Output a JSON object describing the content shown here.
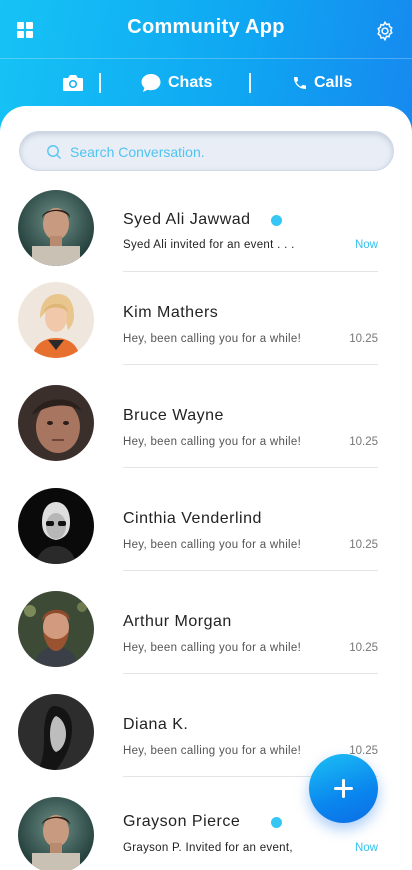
{
  "header": {
    "title": "Community App",
    "menu_icon": "grid-icon",
    "settings_icon": "gear-icon"
  },
  "tabs": [
    {
      "id": "camera",
      "label": "",
      "icon": "camera-icon"
    },
    {
      "id": "chats",
      "label": "Chats",
      "icon": "chat-bubble-icon"
    },
    {
      "id": "calls",
      "label": "Calls",
      "icon": "phone-icon"
    }
  ],
  "search": {
    "placeholder": "Search Conversation."
  },
  "conversations": [
    {
      "name": "Syed Ali Jawwad",
      "preview": "Syed Ali invited for an event . . .",
      "time": "Now",
      "unread": true
    },
    {
      "name": "Kim Mathers",
      "preview": "Hey, been calling you for a while!",
      "time": "10.25",
      "unread": false
    },
    {
      "name": "Bruce Wayne",
      "preview": "Hey, been calling you for a while!",
      "time": "10.25",
      "unread": false
    },
    {
      "name": "Cinthia Venderlind",
      "preview": "Hey, been calling you for a while!",
      "time": "10.25",
      "unread": false
    },
    {
      "name": "Arthur Morgan",
      "preview": "Hey, been calling you for a while!",
      "time": "10.25",
      "unread": false
    },
    {
      "name": "Diana K.",
      "preview": "Hey, been calling you for a while!",
      "time": "10.25",
      "unread": false
    },
    {
      "name": "Grayson Pierce",
      "preview": "Grayson P. Invited for an event,",
      "time": "Now",
      "unread": true
    }
  ],
  "fab": {
    "icon": "plus-icon"
  },
  "colors": {
    "header_gradient_start": "#16c3f5",
    "header_gradient_end": "#1b74ee",
    "accent": "#36c6f4"
  }
}
